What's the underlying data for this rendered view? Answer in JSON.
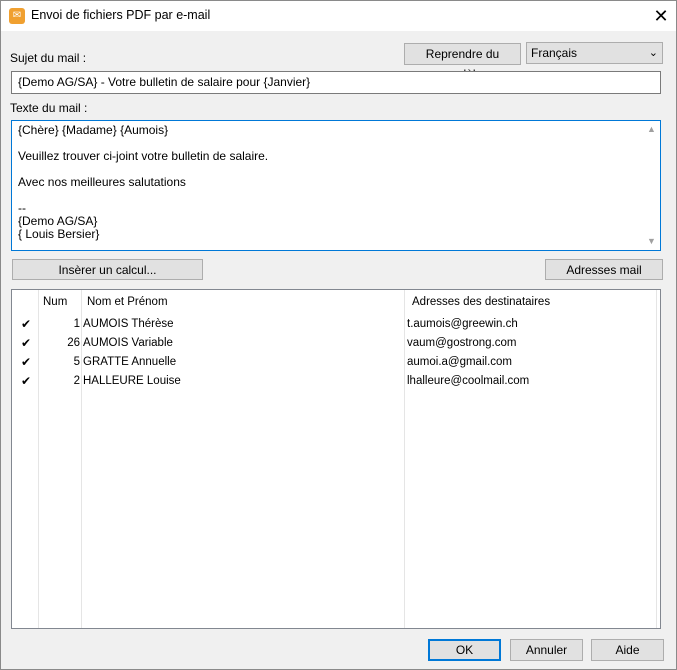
{
  "window": {
    "title": "Envoi de fichiers PDF par e-mail",
    "icon": "app-icon"
  },
  "subject": {
    "label": "Sujet du mail :",
    "value": "{Demo AG/SA} - Votre bulletin de salaire pour {Janvier}"
  },
  "template_button": "Reprendre du modèle",
  "language": {
    "selected": "Français"
  },
  "body": {
    "label": "Texte du mail :",
    "lines": [
      "{Chère} {Madame} {Aumois}",
      "",
      "Veuillez trouver ci-joint votre bulletin de salaire.",
      "",
      "Avec nos meilleures salutations",
      "",
      "--",
      "{Demo AG/SA}",
      "{ Louis Bersier}"
    ]
  },
  "insert_calc_button": "Insèrer un calcul...",
  "addresses_button": "Adresses mail",
  "table": {
    "columns": [
      "Num",
      "Nom et Prénom",
      "Adresses des destinataires"
    ],
    "rows": [
      {
        "checked": "✔",
        "num": "1",
        "name": "AUMOIS Thérèse",
        "mail": "t.aumois@greewin.ch"
      },
      {
        "checked": "✔",
        "num": "26",
        "name": "AUMOIS Variable",
        "mail": "vaum@gostrong.com"
      },
      {
        "checked": "✔",
        "num": "5",
        "name": "GRATTE Annuelle",
        "mail": "aumoi.a@gmail.com"
      },
      {
        "checked": "✔",
        "num": "2",
        "name": "HALLEURE Louise",
        "mail": "lhalleure@coolmail.com"
      }
    ]
  },
  "footer": {
    "ok": "OK",
    "cancel": "Annuler",
    "help": "Aide"
  }
}
